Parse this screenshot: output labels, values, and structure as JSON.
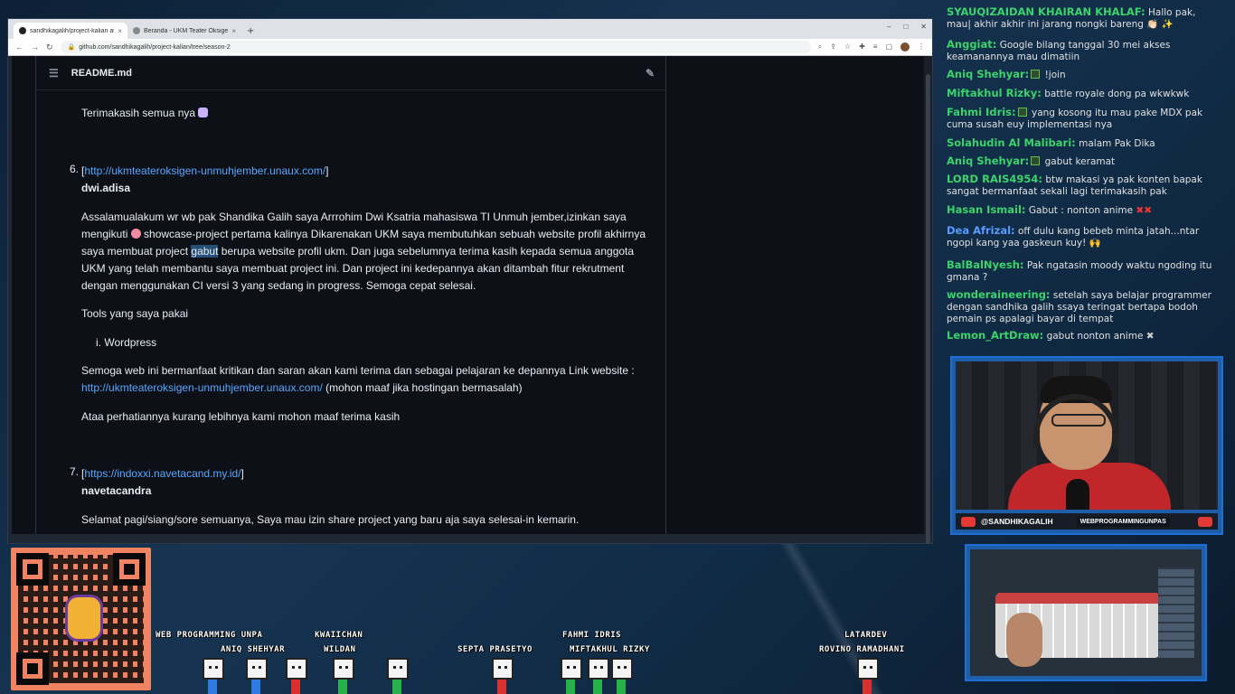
{
  "browser": {
    "tabs": [
      {
        "label": "sandhikagalih/project-kalian at se",
        "active": true
      },
      {
        "label": "Beranda - UKM Teater Oksigen",
        "active": false
      }
    ],
    "new_tab": "+",
    "url": "github.com/sandhikagalih/project-kalian/tree/season-2",
    "window_controls": [
      "–",
      "□",
      "✕"
    ]
  },
  "readme": {
    "filename": "README.md",
    "thanks_line": "Terimakasih semua nya",
    "entries": [
      {
        "number": "6.",
        "link": "http://ukmteateroksigen-unmuhjember.unaux.com/",
        "author": "dwi.adisa",
        "para1_a": "Assalamualakum wr wb pak Shandika Galih saya Arrrohim Dwi Ksatria mahasiswa TI Unmuh jember,izinkan saya mengikuti",
        "para1_b": "showcase-project pertama kalinya Dikarenakan UKM saya membutuhkan sebuah website profil akhirnya saya membuat project",
        "para1_hl": "gabut",
        "para1_c": "berupa website profil ukm. Dan juga sebelumnya terima kasih kepada semua anggota UKM yang telah membantu saya membuat project ini. Dan project ini kedepannya akan ditambah fitur rekrutment dengan menggunakan CI versi 3 yang sedang in progress. Semoga cepat selesai.",
        "tools_heading": "Tools yang saya pakai",
        "tools_item": "i. Wordpress",
        "para2_a": "Semoga web ini bermanfaat kritikan dan saran akan kami terima dan sebagai pelajaran ke depannya Link website :",
        "para2_link": "http://ukmteateroksigen-unmuhjember.unaux.com/",
        "para2_b": "(mohon maaf jika hostingan bermasalah)",
        "para3": "Ataa perhatiannya kurang lebihnya kami mohon maaf terima kasih"
      },
      {
        "number": "7.",
        "link": "https://indoxxi.navetacand.my.id/",
        "author": "navetacandra",
        "para1": "Selamat pagi/siang/sore semuanya, Saya mau izin share project yang baru aja saya selesai-in kemarin."
      }
    ]
  },
  "chat": [
    {
      "name": "SYAUQIZAIDAN KHAIRAN KHALAF:",
      "text": "Hallo pak, mau| akhir akhir ini jarang nongki bareng 👏🏻 ✨"
    },
    {
      "name": "Anggiat:",
      "text": "Google bilang tanggal 30 mei akses keamanannya mau dimatiin"
    },
    {
      "name": "Aniq Shehyar:",
      "text": "!join"
    },
    {
      "name": "Miftakhul Rizky:",
      "text": "battle royale dong pa wkwkwk"
    },
    {
      "name": "Fahmi Idris:",
      "text": "yang kosong itu mau pake MDX pak cuma susah euy implementasi nya"
    },
    {
      "name": "Solahudin Al Malibari:",
      "text": "malam Pak Dika"
    },
    {
      "name": "Aniq Shehyar:",
      "text": "gabut keramat"
    },
    {
      "name": "LORD RAIS4954:",
      "text": "btw makasi ya pak konten bapak sangat bermanfaat sekali lagi terimakasih pak"
    },
    {
      "name": "Hasan Ismail:",
      "text": "Gabut : nonton anime"
    },
    {
      "name": "Dea Afrizal:",
      "text": "off dulu kang bebeb minta jatah...ntar ngopi kang yaa gaskeun kuy! 🙌"
    },
    {
      "name": "BalBalNyesh:",
      "text": "Pak ngatasin moody waktu ngoding itu gmana ?"
    },
    {
      "name": "wonderaineering:",
      "text": "setelah saya belajar programmer dengan sandhika galih ssaya teringat bertapa bodoh pemain ps apalagi bayar di tempat"
    },
    {
      "name": "Lemon_ArtDraw:",
      "text": "gabut nonton anime"
    }
  ],
  "cam": {
    "handle": "@SANDHIKAGALIH",
    "channel": "WEBPROGRAMMINGUNPAS"
  },
  "viewers": [
    {
      "name": "WEB PROGRAMMING UNPA"
    },
    {
      "name": "ANIQ SHEHYAR"
    },
    {
      "name": "KWAIICHAN"
    },
    {
      "name": "WILDAN"
    },
    {
      "name": "SEPTA PRASETYO"
    },
    {
      "name": "FAHMI IDRIS"
    },
    {
      "name": "MIFTAKHUL RIZKY"
    },
    {
      "name": "LATARDEV"
    },
    {
      "name": "ROVINO RAMADHANI"
    }
  ],
  "colors": {
    "link": "#58a6ff",
    "chat_name": "#3bd36b",
    "chat_name_alt": "#5b9cff",
    "qr_bg": "#f08462",
    "cam_border": "#1d6fd6"
  }
}
